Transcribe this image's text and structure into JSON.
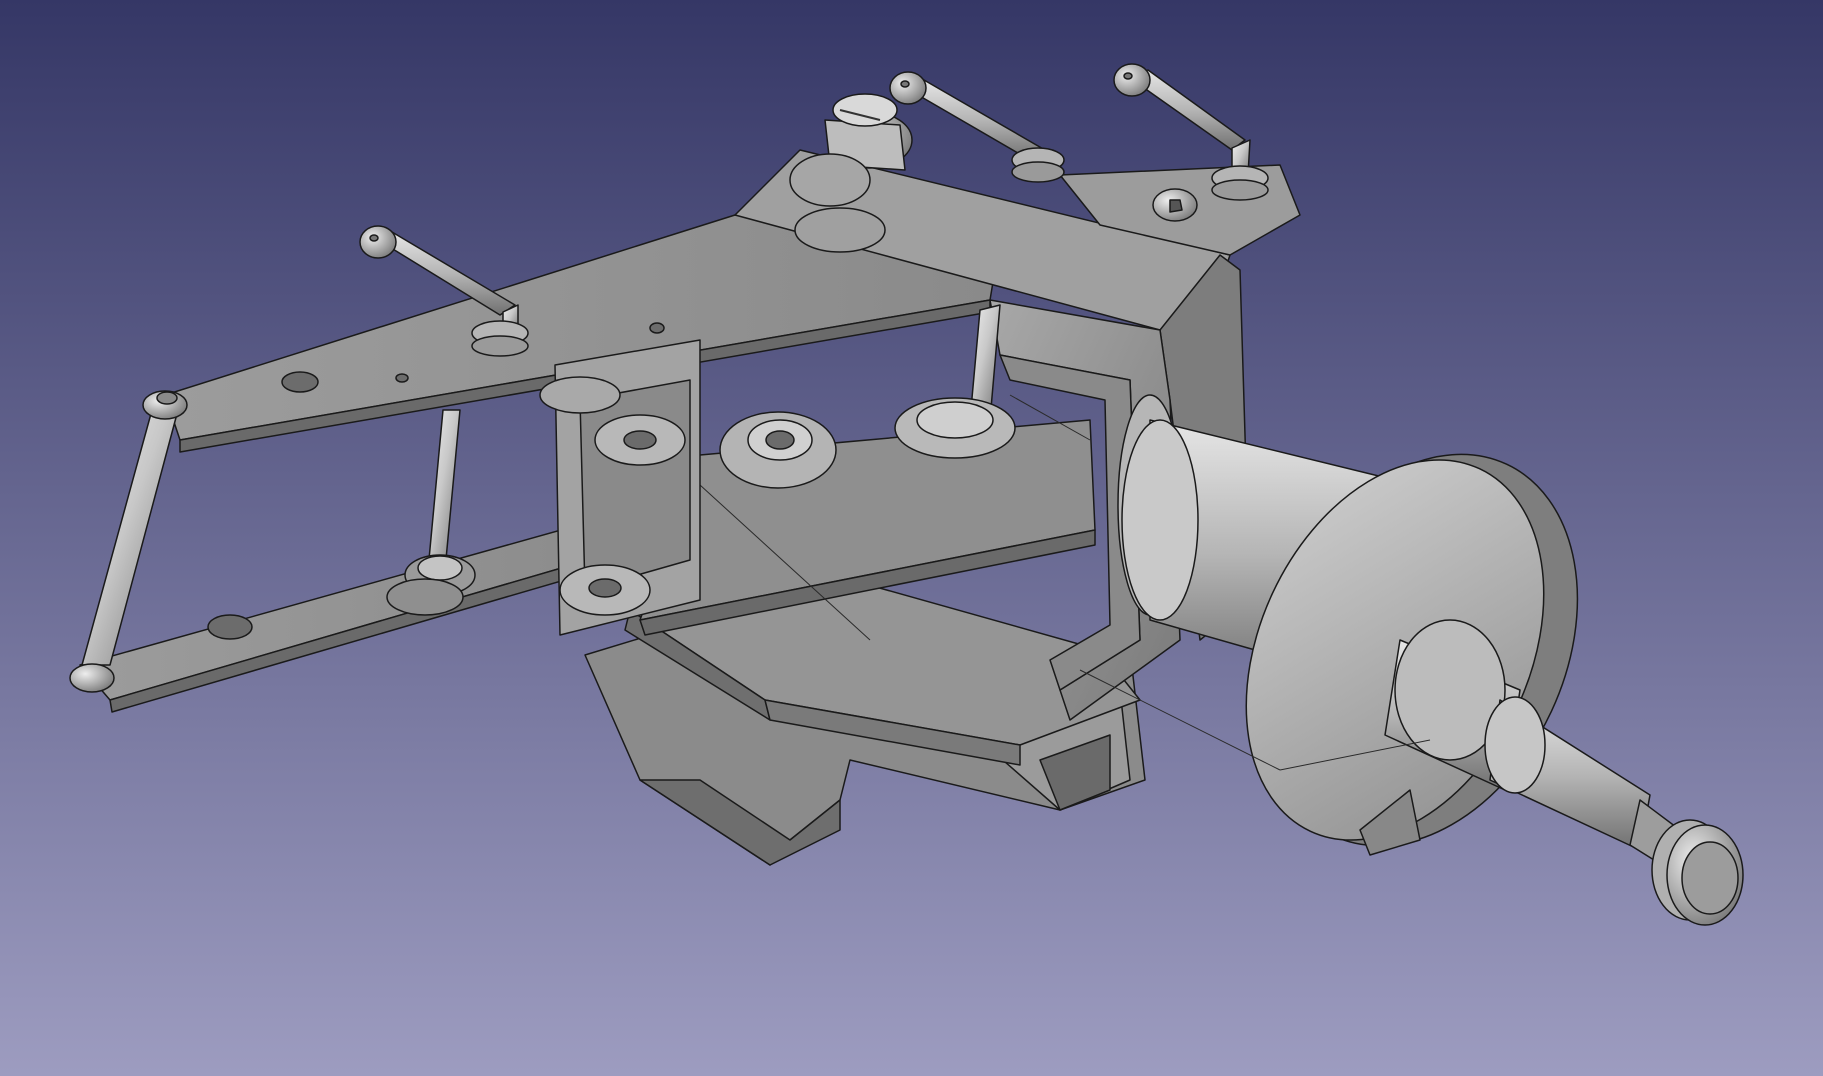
{
  "app": {
    "kind": "3D CAD viewport",
    "view": "isometric"
  },
  "viewport": {
    "background_top": "#353766",
    "background_bottom": "#9d9cc0"
  },
  "model": {
    "shade_light": "#d6d6d6",
    "shade_mid": "#a9a9a9",
    "shade_dark": "#6f6f6f",
    "edge_color": "#1a1a1a"
  },
  "icons": {
    "model": "cad-assembly-icon"
  }
}
